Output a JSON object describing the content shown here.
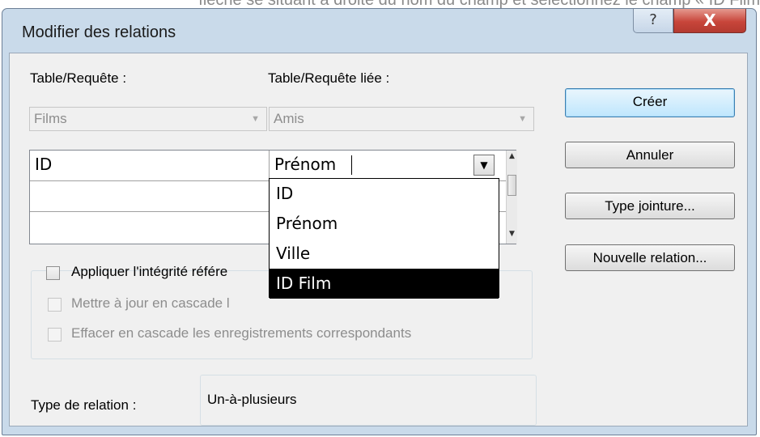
{
  "top_caption": "flèche se situant à droite du nom du champ et sélectionnez le champ « ID Film",
  "window": {
    "title": "Modifier des relations",
    "help_glyph": "?",
    "close_glyph": "X"
  },
  "table_query": {
    "label": "Table/Requête :",
    "value": "Films"
  },
  "linked_table_query": {
    "label": "Table/Requête liée :",
    "value": "Amis"
  },
  "grid": {
    "rows": [
      {
        "left": "ID",
        "right": "Prénom"
      },
      {
        "left": "",
        "right": ""
      },
      {
        "left": "",
        "right": ""
      }
    ]
  },
  "dropdown": {
    "options": [
      "ID",
      "Prénom",
      "Ville",
      "ID Film"
    ],
    "selected": "ID Film"
  },
  "buttons": {
    "create": "Créer",
    "cancel": "Annuler",
    "join_type": "Type jointure...",
    "new_relation": "Nouvelle relation..."
  },
  "checkboxes": {
    "referential_integrity": "Appliquer l'intégrité référe",
    "cascade_update": "Mettre à jour en cascade l",
    "cascade_delete": "Effacer en cascade les enregistrements correspondants"
  },
  "relation_type": {
    "label": "Type de relation :",
    "value": "Un-à-plusieurs"
  },
  "colors": {
    "title_bar": "#c9daea",
    "close_button": "#c8453a",
    "dropdown_selection": "#000000",
    "default_button": "#bee6fd"
  }
}
